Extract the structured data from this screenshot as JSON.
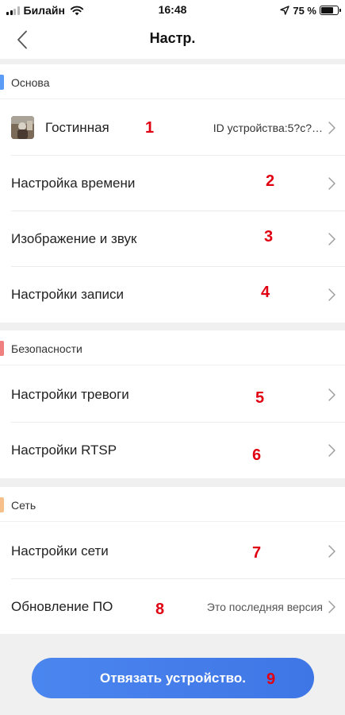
{
  "status_bar": {
    "carrier": "Билайн",
    "time": "16:48",
    "battery_percent": "75 %",
    "battery_level": 0.75,
    "signal_bars": 4,
    "signal_active": 2
  },
  "nav": {
    "title": "Настр.",
    "back_icon": "chevron-left-icon"
  },
  "sections": [
    {
      "title": "Основа",
      "accent": "#5b9cf6",
      "rows": [
        {
          "label": "Гостинная",
          "value": "ID устройства:5?c?…",
          "annotation": "1",
          "thumb": "camera-thumbnail"
        },
        {
          "label": "Настройка времени",
          "annotation": "2"
        },
        {
          "label": "Изображение и звук",
          "annotation": "3"
        },
        {
          "label": "Настройки записи",
          "annotation": "4"
        }
      ]
    },
    {
      "title": "Безопасности",
      "accent": "#f08080",
      "rows": [
        {
          "label": "Настройки тревоги",
          "annotation": "5"
        },
        {
          "label": "Настройки RTSP",
          "annotation": "6"
        }
      ]
    },
    {
      "title": "Сеть",
      "accent": "#f7c08a",
      "rows": [
        {
          "label": "Настройки сети",
          "annotation": "7"
        },
        {
          "label": "Обновление ПО",
          "value": "Это последняя версия",
          "annotation": "8"
        }
      ]
    }
  ],
  "unbind_button": {
    "label": "Отвязать устройство.",
    "annotation": "9",
    "color": "#4480ec"
  },
  "colors": {
    "annotation": "#e00012",
    "page_gap": "#f0f0f0"
  }
}
